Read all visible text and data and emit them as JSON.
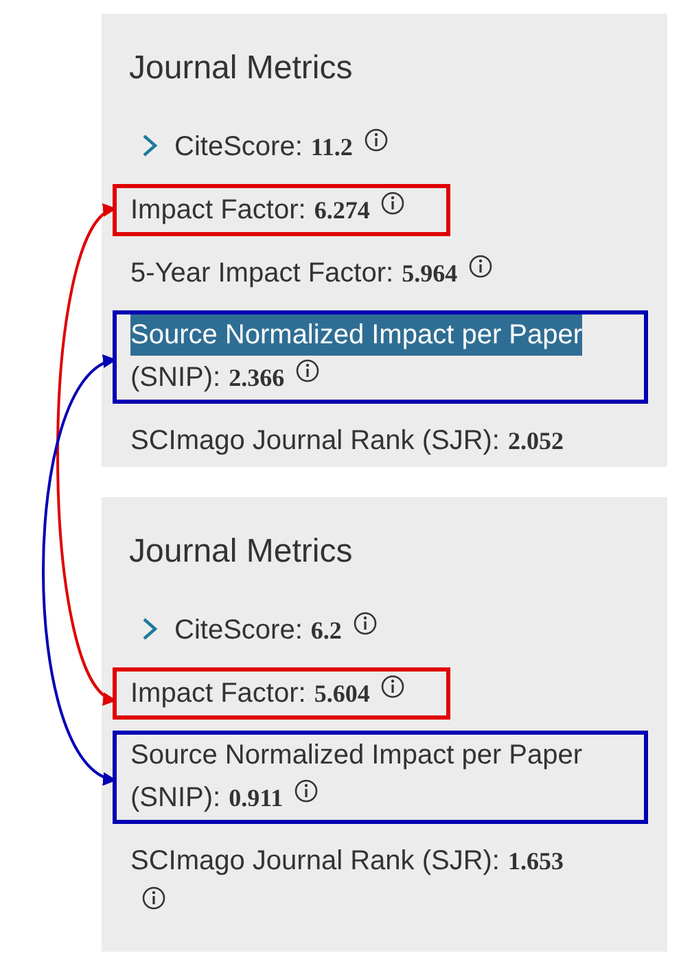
{
  "panels": [
    {
      "title": "Journal Metrics",
      "metrics": [
        {
          "kind": "expandable",
          "label": "CiteScore:",
          "value": "11.2",
          "info": true
        },
        {
          "kind": "plain",
          "label": "Impact Factor:",
          "value": "6.274",
          "info": true,
          "color": "#e00000"
        },
        {
          "kind": "plain",
          "label": "5-Year Impact Factor:",
          "value": "5.964",
          "info": true
        },
        {
          "kind": "plain",
          "label": "Source Normalized Impact per Paper",
          "label_2": "(SNIP):",
          "value": "2.366",
          "info": true,
          "color": "#0000b4",
          "highlighted": true
        },
        {
          "kind": "plain",
          "label": "SCImago Journal Rank (SJR):",
          "value": "2.052",
          "info": false
        }
      ]
    },
    {
      "title": "Journal Metrics",
      "metrics": [
        {
          "kind": "expandable",
          "label": "CiteScore:",
          "value": "6.2",
          "info": true
        },
        {
          "kind": "plain",
          "label": "Impact Factor:",
          "value": "5.604",
          "info": true,
          "color": "#e00000"
        },
        {
          "kind": "plain",
          "label": "Source Normalized Impact per Paper",
          "label_2": "(SNIP):",
          "value": "0.911",
          "info": true,
          "color": "#0000b4",
          "highlighted": false
        },
        {
          "kind": "plain",
          "label": "SCImago Journal Rank (SJR):",
          "value": "1.653",
          "info": true
        }
      ]
    }
  ],
  "arrows": [
    {
      "color": "#e00000"
    },
    {
      "color": "#0000b4"
    }
  ]
}
